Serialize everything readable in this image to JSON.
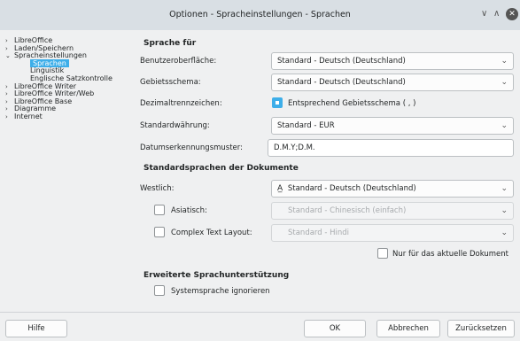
{
  "window": {
    "title": "Optionen - Spracheinstellungen - Sprachen"
  },
  "tree": [
    {
      "label": "LibreOffice",
      "level": 0,
      "arrow": true
    },
    {
      "label": "Laden/Speichern",
      "level": 0,
      "arrow": true
    },
    {
      "label": "Spracheinstellungen",
      "level": 0,
      "arrow": true,
      "expanded": true
    },
    {
      "label": "Sprachen",
      "level": 1,
      "selected": true
    },
    {
      "label": "Linguistik",
      "level": 1
    },
    {
      "label": "Englische Satzkontrolle",
      "level": 1
    },
    {
      "label": "LibreOffice Writer",
      "level": 0,
      "arrow": true
    },
    {
      "label": "LibreOffice Writer/Web",
      "level": 0,
      "arrow": true
    },
    {
      "label": "LibreOffice Base",
      "level": 0,
      "arrow": true
    },
    {
      "label": "Diagramme",
      "level": 0,
      "arrow": true
    },
    {
      "label": "Internet",
      "level": 0,
      "arrow": true
    }
  ],
  "sprache_fuer": {
    "heading": "Sprache für",
    "ui_label": "Benutzeroberfläche:",
    "ui_value": "Standard - Deutsch (Deutschland)",
    "locale_label": "Gebietsschema:",
    "locale_value": "Standard - Deutsch (Deutschland)",
    "decimal_label": "Dezimaltrennzeichen:",
    "decimal_check_label": "Entsprechend Gebietsschema ( , )",
    "decimal_checked": true,
    "currency_label": "Standardwährung:",
    "currency_value": "Standard - EUR",
    "date_label": "Datumserkennungsmuster:",
    "date_value": "D.M.Y;D.M."
  },
  "standardsprachen": {
    "heading": "Standardsprachen der Dokumente",
    "western_label": "Westlich:",
    "western_value": "Standard - Deutsch (Deutschland)",
    "asian_label": "Asiatisch:",
    "asian_value": "Standard - Chinesisch (einfach)",
    "asian_checked": false,
    "ctl_label": "Complex Text Layout:",
    "ctl_value": "Standard - Hindi",
    "ctl_checked": false,
    "current_doc_label": "Nur für das aktuelle Dokument",
    "current_doc_checked": false
  },
  "erweitert": {
    "heading": "Erweiterte Sprachunterstützung",
    "ignore_label": "Systemsprache ignorieren",
    "ignore_checked": false
  },
  "buttons": {
    "help": "Hilfe",
    "ok": "OK",
    "cancel": "Abbrechen",
    "reset": "Zurücksetzen"
  },
  "icons": {
    "minimize": "chevron-down-icon",
    "maximize": "chevron-up-icon",
    "close": "close-icon"
  },
  "colors": {
    "accent": "#3daee9"
  }
}
